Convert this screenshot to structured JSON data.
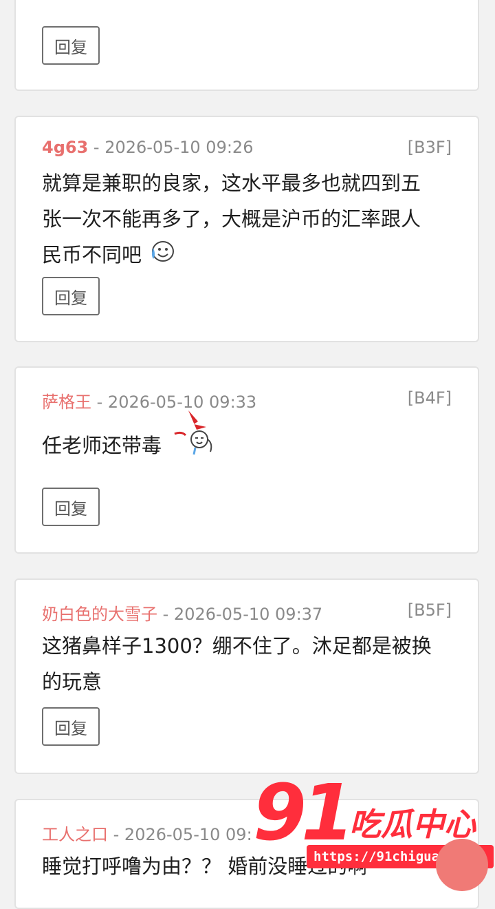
{
  "reply_label": "回复",
  "comments": [
    {
      "author": "4g63",
      "sep": " - ",
      "time": "2026-05-10 09:26",
      "floor": "[B3F]",
      "text": "就算是兼职的良家，这水平最多也就四到五张一次不能再多了，大概是沪币的汇率跟人民币不同吧",
      "emoji": "sweat-smile-icon"
    },
    {
      "author": "萨格王",
      "sep": " - ",
      "time": "2026-05-10 09:33",
      "floor": "[B4F]",
      "text": "任老师还带毒",
      "emoji": "bleeding-face-icon"
    },
    {
      "author": "奶白色的大雪子",
      "sep": " - ",
      "time": "2026-05-10 09:37",
      "floor": "[B5F]",
      "text": "这猪鼻样子1300？绷不住了。沐足都是被换的玩意"
    },
    {
      "author": "工人之口",
      "sep": " - ",
      "time": "2026-05-10 09:",
      "text": "睡觉打呼噜为由？？ 婚前没睡过的啊"
    }
  ],
  "watermark": {
    "number": "91",
    "title": "吃瓜中心",
    "url": "https://91chigua32.com"
  },
  "colors": {
    "author": "#e8706e",
    "watermark": "#ff2e3c"
  }
}
